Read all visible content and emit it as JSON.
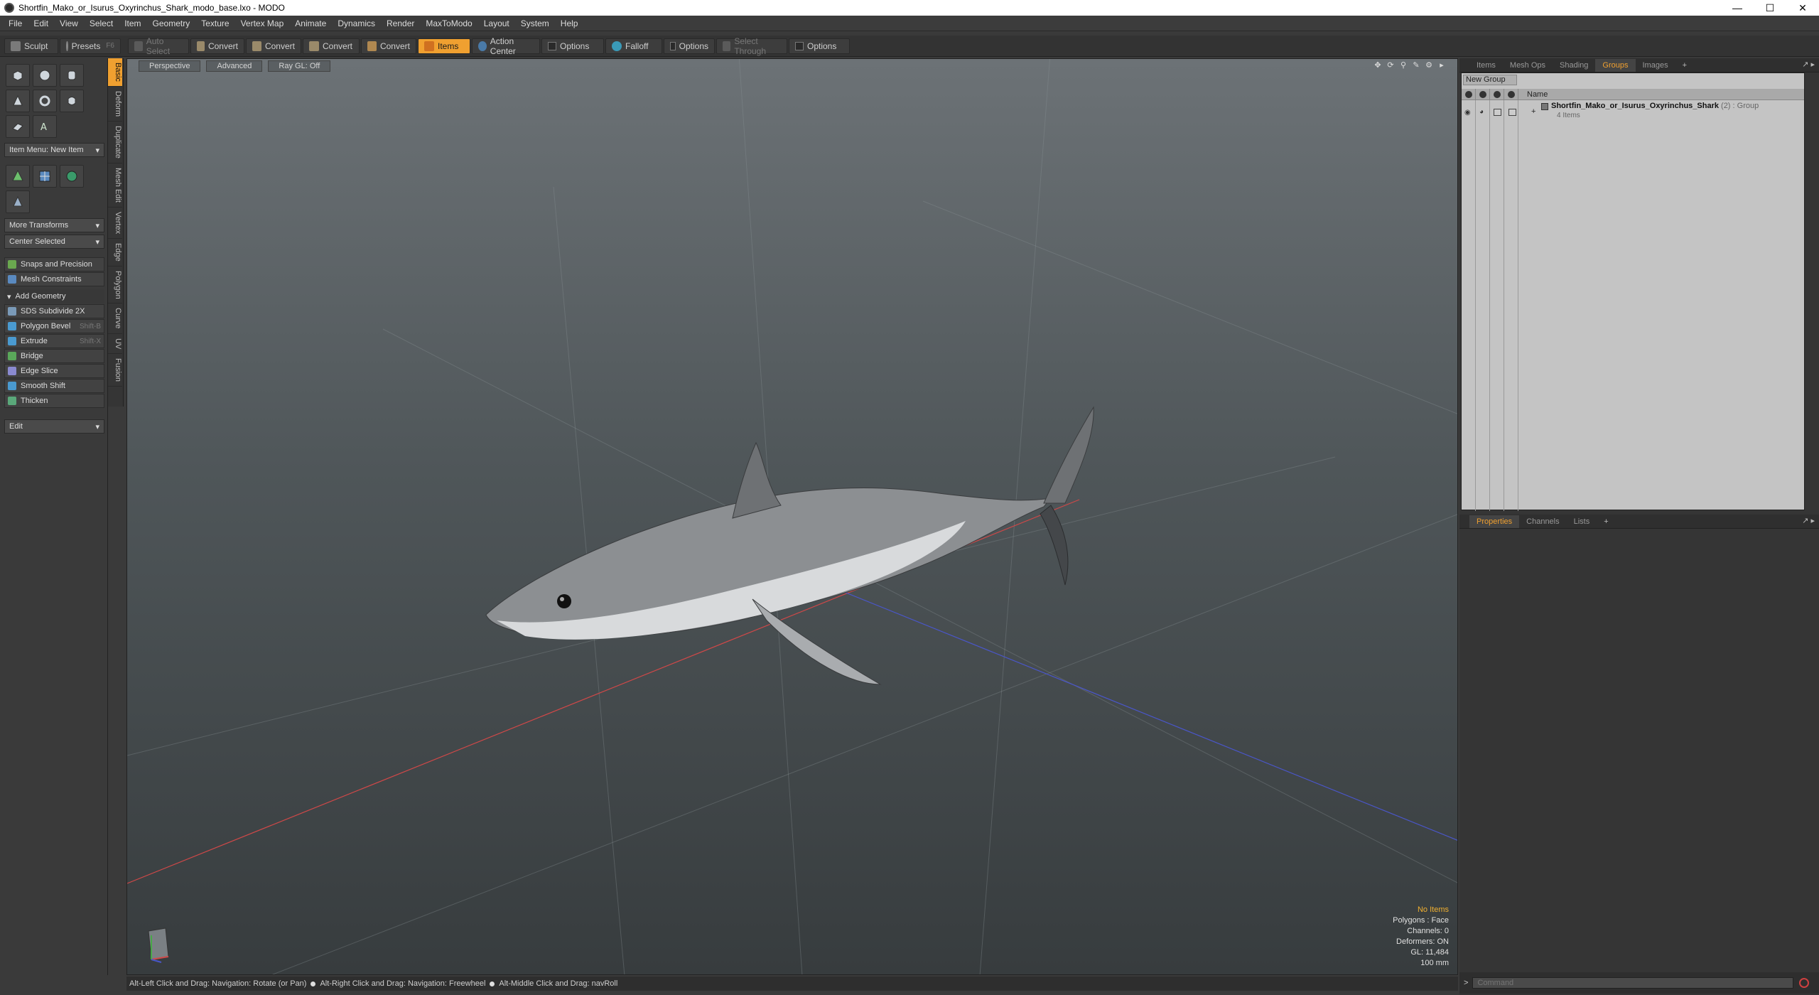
{
  "window": {
    "title": "Shortfin_Mako_or_Isurus_Oxyrinchus_Shark_modo_base.lxo - MODO"
  },
  "menu": [
    "File",
    "Edit",
    "View",
    "Select",
    "Item",
    "Geometry",
    "Texture",
    "Vertex Map",
    "Animate",
    "Dynamics",
    "Render",
    "MaxToModo",
    "Layout",
    "System",
    "Help"
  ],
  "toolbar": {
    "sculpt": "Sculpt",
    "presets": "Presets",
    "presets_sc": "F6",
    "auto_select": "Auto Select",
    "convert": "Convert",
    "items": "Items",
    "action_center": "Action Center",
    "options": "Options",
    "falloff": "Falloff",
    "select_through": "Select Through"
  },
  "toolbox": {
    "item_menu": "Item Menu: New Item",
    "more_transforms": "More Transforms",
    "center_selected": "Center Selected",
    "snaps": "Snaps and Precision",
    "mesh_constraints": "Mesh Constraints",
    "add_geometry": "Add Geometry",
    "tools": [
      {
        "label": "SDS Subdivide 2X",
        "shortcut": ""
      },
      {
        "label": "Polygon Bevel",
        "shortcut": "Shift-B"
      },
      {
        "label": "Extrude",
        "shortcut": "Shift-X"
      },
      {
        "label": "Bridge",
        "shortcut": ""
      },
      {
        "label": "Edge Slice",
        "shortcut": ""
      },
      {
        "label": "Smooth Shift",
        "shortcut": ""
      },
      {
        "label": "Thicken",
        "shortcut": ""
      }
    ],
    "edit": "Edit",
    "vtabs": [
      "Basic",
      "Deform",
      "Duplicate",
      "Mesh Edit",
      "Vertex",
      "Edge",
      "Polygon",
      "Curve",
      "UV",
      "Fusion"
    ]
  },
  "viewport": {
    "tabs": [
      "Perspective",
      "Advanced",
      "Ray GL: Off"
    ],
    "info": {
      "no_items": "No Items",
      "polygons": "Polygons : Face",
      "channels": "Channels: 0",
      "deformers": "Deformers: ON",
      "gl": "GL: 11,484",
      "scale": "100 mm"
    }
  },
  "statusbar": {
    "hint1": "Alt-Left Click and Drag: Navigation: Rotate (or Pan)",
    "hint2": "Alt-Right Click and Drag: Navigation: Freewheel",
    "hint3": "Alt-Middle Click and Drag: navRoll"
  },
  "right_panel": {
    "tabs": [
      "Items",
      "Mesh Ops",
      "Shading",
      "Groups",
      "Images",
      "+"
    ],
    "active_tab": "Groups",
    "new_group": "New Group",
    "name_header": "Name",
    "group": {
      "name": "Shortfin_Mako_or_Isurus_Oxyrinchus_Shark",
      "count": "(2)",
      "type": ": Group",
      "subtitle": "4 Items"
    },
    "props_tabs": [
      "Properties",
      "Channels",
      "Lists",
      "+"
    ],
    "command_placeholder": "Command"
  },
  "colors": {
    "accent": "#f0a030"
  }
}
